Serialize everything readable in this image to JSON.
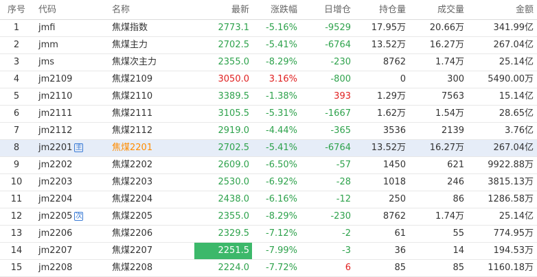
{
  "headers": {
    "idx": "序号",
    "code": "代码",
    "name": "名称",
    "last": "最新",
    "chg": "涨跌幅",
    "oi": "日增仓",
    "hold": "持仓量",
    "vol": "成交量",
    "amt": "金额"
  },
  "rows": [
    {
      "idx": "1",
      "code": "jmfi",
      "tag": "",
      "name": "焦煤指数",
      "last": "2773.1",
      "chg": "-5.16%",
      "oi": "-9529",
      "hold": "17.95万",
      "vol": "20.66万",
      "amt": "341.99亿",
      "dir": "down",
      "oi_dir": "down"
    },
    {
      "idx": "2",
      "code": "jmm",
      "tag": "",
      "name": "焦煤主力",
      "last": "2702.5",
      "chg": "-5.41%",
      "oi": "-6764",
      "hold": "13.52万",
      "vol": "16.27万",
      "amt": "267.04亿",
      "dir": "down",
      "oi_dir": "down"
    },
    {
      "idx": "3",
      "code": "jms",
      "tag": "",
      "name": "焦煤次主力",
      "last": "2355.0",
      "chg": "-8.29%",
      "oi": "-230",
      "hold": "8762",
      "vol": "1.74万",
      "amt": "25.14亿",
      "dir": "down",
      "oi_dir": "down"
    },
    {
      "idx": "4",
      "code": "jm2109",
      "tag": "",
      "name": "焦煤2109",
      "last": "3050.0",
      "chg": "3.16%",
      "oi": "-800",
      "hold": "0",
      "vol": "300",
      "amt": "5490.00万",
      "dir": "up",
      "oi_dir": "down"
    },
    {
      "idx": "5",
      "code": "jm2110",
      "tag": "",
      "name": "焦煤2110",
      "last": "3389.5",
      "chg": "-1.38%",
      "oi": "393",
      "hold": "1.29万",
      "vol": "7563",
      "amt": "15.14亿",
      "dir": "down",
      "oi_dir": "up"
    },
    {
      "idx": "6",
      "code": "jm2111",
      "tag": "",
      "name": "焦煤2111",
      "last": "3105.5",
      "chg": "-5.31%",
      "oi": "-1667",
      "hold": "1.62万",
      "vol": "1.54万",
      "amt": "28.65亿",
      "dir": "down",
      "oi_dir": "down"
    },
    {
      "idx": "7",
      "code": "jm2112",
      "tag": "",
      "name": "焦煤2112",
      "last": "2919.0",
      "chg": "-4.44%",
      "oi": "-365",
      "hold": "3536",
      "vol": "2139",
      "amt": "3.76亿",
      "dir": "down",
      "oi_dir": "down"
    },
    {
      "idx": "8",
      "code": "jm2201",
      "tag": "主",
      "name": "焦煤2201",
      "last": "2702.5",
      "chg": "-5.41%",
      "oi": "-6764",
      "hold": "13.52万",
      "vol": "16.27万",
      "amt": "267.04亿",
      "dir": "down",
      "oi_dir": "down",
      "selected": true
    },
    {
      "idx": "9",
      "code": "jm2202",
      "tag": "",
      "name": "焦煤2202",
      "last": "2609.0",
      "chg": "-6.50%",
      "oi": "-57",
      "hold": "1450",
      "vol": "621",
      "amt": "9922.88万",
      "dir": "down",
      "oi_dir": "down"
    },
    {
      "idx": "10",
      "code": "jm2203",
      "tag": "",
      "name": "焦煤2203",
      "last": "2530.0",
      "chg": "-6.92%",
      "oi": "-28",
      "hold": "1018",
      "vol": "246",
      "amt": "3815.13万",
      "dir": "down",
      "oi_dir": "down"
    },
    {
      "idx": "11",
      "code": "jm2204",
      "tag": "",
      "name": "焦煤2204",
      "last": "2438.0",
      "chg": "-6.16%",
      "oi": "-12",
      "hold": "250",
      "vol": "86",
      "amt": "1286.58万",
      "dir": "down",
      "oi_dir": "down"
    },
    {
      "idx": "12",
      "code": "jm2205",
      "tag": "次",
      "name": "焦煤2205",
      "last": "2355.0",
      "chg": "-8.29%",
      "oi": "-230",
      "hold": "8762",
      "vol": "1.74万",
      "amt": "25.14亿",
      "dir": "down",
      "oi_dir": "down"
    },
    {
      "idx": "13",
      "code": "jm2206",
      "tag": "",
      "name": "焦煤2206",
      "last": "2329.5",
      "chg": "-7.12%",
      "oi": "-2",
      "hold": "61",
      "vol": "55",
      "amt": "774.95万",
      "dir": "down",
      "oi_dir": "down"
    },
    {
      "idx": "14",
      "code": "jm2207",
      "tag": "",
      "name": "焦煤2207",
      "last": "2251.5",
      "chg": "-7.99%",
      "oi": "-3",
      "hold": "36",
      "vol": "14",
      "amt": "194.53万",
      "dir": "down",
      "oi_dir": "down",
      "flash": true
    },
    {
      "idx": "15",
      "code": "jm2208",
      "tag": "",
      "name": "焦煤2208",
      "last": "2224.0",
      "chg": "-7.72%",
      "oi": "6",
      "hold": "85",
      "vol": "85",
      "amt": "1160.18万",
      "dir": "down",
      "oi_dir": "up"
    }
  ],
  "colors": {
    "up": "#e02020",
    "down": "#2ea24c",
    "selected_bg": "#e6edf8",
    "selected_name": "#ff8c00",
    "flash_bg": "#3cb86a",
    "tag": "#3a7bd5"
  }
}
